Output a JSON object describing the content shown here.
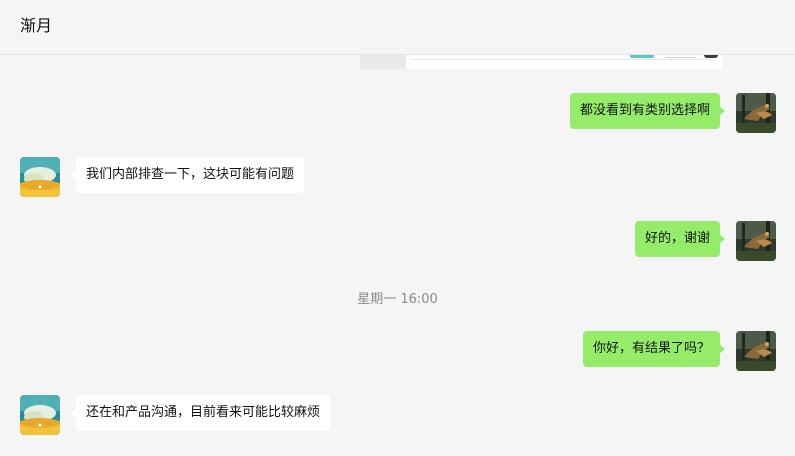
{
  "header": {
    "title": "渐月"
  },
  "messages": [
    {
      "side": "out",
      "text": "都没看到有类别选择啊"
    },
    {
      "side": "in",
      "text": "我们内部排查一下，这块可能有问题"
    },
    {
      "side": "out",
      "text": "好的，谢谢"
    },
    {
      "side": "in_separator",
      "text": "星期一 16:00"
    },
    {
      "side": "out",
      "text": "你好，有结果了吗？"
    },
    {
      "side": "in",
      "text": "还在和产品沟通，目前看来可能比较麻烦"
    }
  ],
  "timestamp": "星期一 16:00",
  "colors": {
    "outgoing_bubble": "#95ec69",
    "incoming_bubble": "#ffffff",
    "background": "#f5f5f5"
  },
  "icons": {
    "my_avatar": "bird-photo-avatar",
    "contact_avatar": "landscape-avatar"
  }
}
